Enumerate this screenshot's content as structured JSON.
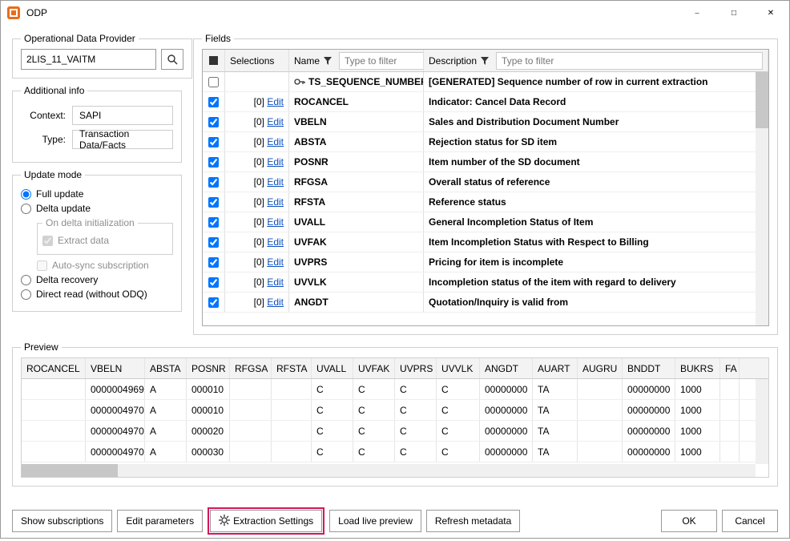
{
  "window": {
    "title": "ODP"
  },
  "odp": {
    "legend": "Operational Data Provider",
    "value": "2LIS_11_VAITM"
  },
  "addinfo": {
    "legend": "Additional info",
    "context_label": "Context:",
    "context_value": "SAPI",
    "type_label": "Type:",
    "type_value": "Transaction Data/Facts"
  },
  "updatemode": {
    "legend": "Update mode",
    "full": "Full update",
    "delta": "Delta update",
    "ondelta_legend": "On delta initialization",
    "extract": "Extract data",
    "autosync": "Auto-sync subscription",
    "recovery": "Delta recovery",
    "direct": "Direct read (without ODQ)"
  },
  "fields": {
    "legend": "Fields",
    "hdr_selections": "Selections",
    "hdr_name": "Name",
    "hdr_description": "Description",
    "filter_placeholder": "Type to filter",
    "rows": [
      {
        "checked": false,
        "sel": "",
        "edit": false,
        "key": true,
        "name": "TS_SEQUENCE_NUMBER",
        "desc": "[GENERATED] Sequence number of row in current extraction"
      },
      {
        "checked": true,
        "sel": "[0]",
        "edit": true,
        "name": "ROCANCEL",
        "desc": "Indicator: Cancel Data Record"
      },
      {
        "checked": true,
        "sel": "[0]",
        "edit": true,
        "name": "VBELN",
        "desc": "Sales and Distribution Document Number"
      },
      {
        "checked": true,
        "sel": "[0]",
        "edit": true,
        "name": "ABSTA",
        "desc": "Rejection status for SD item"
      },
      {
        "checked": true,
        "sel": "[0]",
        "edit": true,
        "name": "POSNR",
        "desc": "Item number of the SD document"
      },
      {
        "checked": true,
        "sel": "[0]",
        "edit": true,
        "name": "RFGSA",
        "desc": "Overall status of reference"
      },
      {
        "checked": true,
        "sel": "[0]",
        "edit": true,
        "name": "RFSTA",
        "desc": "Reference status"
      },
      {
        "checked": true,
        "sel": "[0]",
        "edit": true,
        "name": "UVALL",
        "desc": "General Incompletion Status of Item"
      },
      {
        "checked": true,
        "sel": "[0]",
        "edit": true,
        "name": "UVFAK",
        "desc": "Item Incompletion Status with Respect to Billing"
      },
      {
        "checked": true,
        "sel": "[0]",
        "edit": true,
        "name": "UVPRS",
        "desc": "Pricing for item is incomplete"
      },
      {
        "checked": true,
        "sel": "[0]",
        "edit": true,
        "name": "UVVLK",
        "desc": "Incompletion status of the item with regard to delivery"
      },
      {
        "checked": true,
        "sel": "[0]",
        "edit": true,
        "name": "ANGDT",
        "desc": "Quotation/Inquiry is valid from"
      }
    ],
    "edit_label": "Edit"
  },
  "preview": {
    "legend": "Preview",
    "cols": [
      "ROCANCEL",
      "VBELN",
      "ABSTA",
      "POSNR",
      "RFGSA",
      "RFSTA",
      "UVALL",
      "UVFAK",
      "UVPRS",
      "UVVLK",
      "ANGDT",
      "AUART",
      "AUGRU",
      "BNDDT",
      "BUKRS",
      "FA"
    ],
    "rows": [
      {
        "ROCANCEL": "",
        "VBELN": "0000004969",
        "ABSTA": "A",
        "POSNR": "000010",
        "RFGSA": "",
        "RFSTA": "",
        "UVALL": "C",
        "UVFAK": "C",
        "UVPRS": "C",
        "UVVLK": "C",
        "ANGDT": "00000000",
        "AUART": "TA",
        "AUGRU": "",
        "BNDDT": "00000000",
        "BUKRS": "1000",
        "FA": ""
      },
      {
        "ROCANCEL": "",
        "VBELN": "0000004970",
        "ABSTA": "A",
        "POSNR": "000010",
        "RFGSA": "",
        "RFSTA": "",
        "UVALL": "C",
        "UVFAK": "C",
        "UVPRS": "C",
        "UVVLK": "C",
        "ANGDT": "00000000",
        "AUART": "TA",
        "AUGRU": "",
        "BNDDT": "00000000",
        "BUKRS": "1000",
        "FA": ""
      },
      {
        "ROCANCEL": "",
        "VBELN": "0000004970",
        "ABSTA": "A",
        "POSNR": "000020",
        "RFGSA": "",
        "RFSTA": "",
        "UVALL": "C",
        "UVFAK": "C",
        "UVPRS": "C",
        "UVVLK": "C",
        "ANGDT": "00000000",
        "AUART": "TA",
        "AUGRU": "",
        "BNDDT": "00000000",
        "BUKRS": "1000",
        "FA": ""
      },
      {
        "ROCANCEL": "",
        "VBELN": "0000004970",
        "ABSTA": "A",
        "POSNR": "000030",
        "RFGSA": "",
        "RFSTA": "",
        "UVALL": "C",
        "UVFAK": "C",
        "UVPRS": "C",
        "UVVLK": "C",
        "ANGDT": "00000000",
        "AUART": "TA",
        "AUGRU": "",
        "BNDDT": "00000000",
        "BUKRS": "1000",
        "FA": ""
      }
    ]
  },
  "buttons": {
    "subs": "Show subscriptions",
    "params": "Edit parameters",
    "extract": "Extraction Settings",
    "live": "Load live preview",
    "refresh": "Refresh metadata",
    "ok": "OK",
    "cancel": "Cancel"
  }
}
